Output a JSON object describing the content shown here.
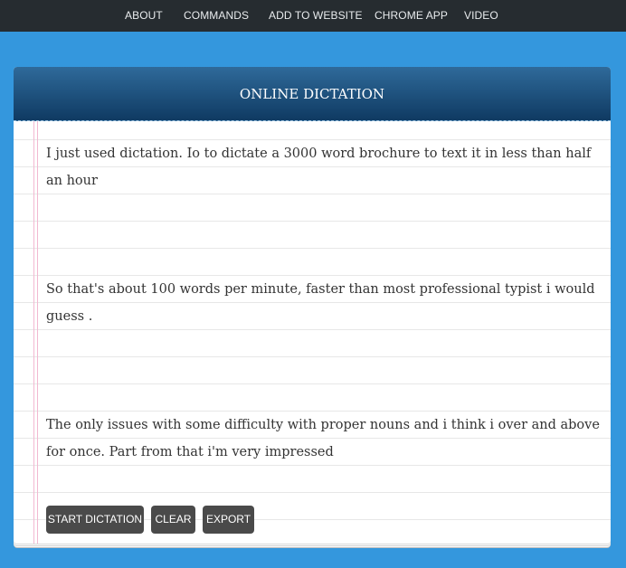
{
  "nav": {
    "items": [
      {
        "label": "ABOUT"
      },
      {
        "label": "COMMANDS"
      },
      {
        "label": "ADD TO WEBSITE"
      },
      {
        "label": "CHROME APP"
      },
      {
        "label": "VIDEO"
      }
    ]
  },
  "panel": {
    "title": "ONLINE DICTATION"
  },
  "editor": {
    "paragraphs": [
      "I just used dictation. Io to dictate a 3000 word brochure to text it in less than half an hour",
      "So that's about 100 words per minute, faster than most professional typist i would guess .",
      "The only issues with some difficulty with proper nouns and i think i over and above for once. Part from that i'm very impressed"
    ]
  },
  "buttons": {
    "start_label": "START DICTATION",
    "clear_label": "CLEAR",
    "export_label": "EXPORT"
  }
}
